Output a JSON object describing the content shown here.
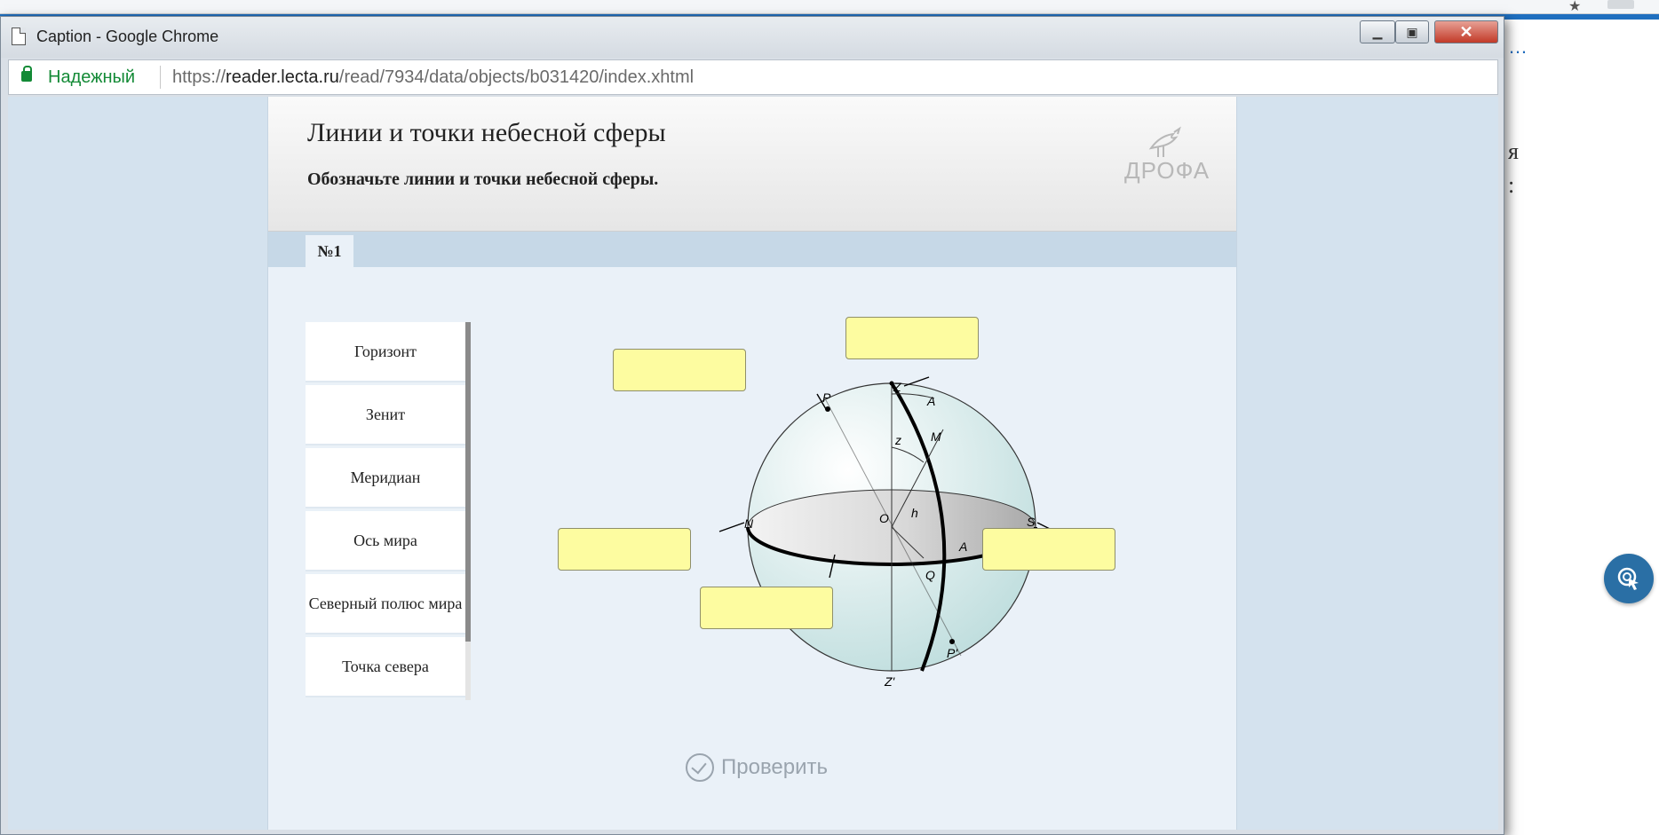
{
  "window": {
    "title": "Caption - Google Chrome",
    "secure_label": "Надежный",
    "url_prefix": "https://",
    "url_domain": "reader.lecta.ru",
    "url_path": "/read/7934/data/objects/b031420/index.xhtml"
  },
  "exercise": {
    "title": "Линии и точки небесной сферы",
    "instruction": "Обозначьте линии и точки небесной сферы.",
    "logo_text": "ДРОФА",
    "tabs": [
      {
        "label": "№1"
      }
    ],
    "terms": [
      {
        "label": "Горизонт"
      },
      {
        "label": "Зенит"
      },
      {
        "label": "Меридиан"
      },
      {
        "label": "Ось мира"
      },
      {
        "label": "Северный полюс мира"
      },
      {
        "label": "Точка севера"
      }
    ],
    "check_label": "Проверить"
  },
  "diagram": {
    "labels": {
      "Z": "Z",
      "P": "P",
      "A_top": "A",
      "z": "z",
      "M": "M",
      "O": "O",
      "h": "h",
      "N": "N",
      "S": "S",
      "A_mid": "A",
      "Q": "Q",
      "P_prime": "P'",
      "Z_prime": "Z'"
    },
    "slots": [
      {
        "id": "slot-zenith",
        "value": ""
      },
      {
        "id": "slot-pole",
        "value": ""
      },
      {
        "id": "slot-north",
        "value": ""
      },
      {
        "id": "slot-south",
        "value": ""
      },
      {
        "id": "slot-axis",
        "value": ""
      }
    ]
  },
  "colors": {
    "slot_fill": "#fdfca0",
    "panel_bg": "#eaf1f8",
    "secure_green": "#138a36"
  }
}
